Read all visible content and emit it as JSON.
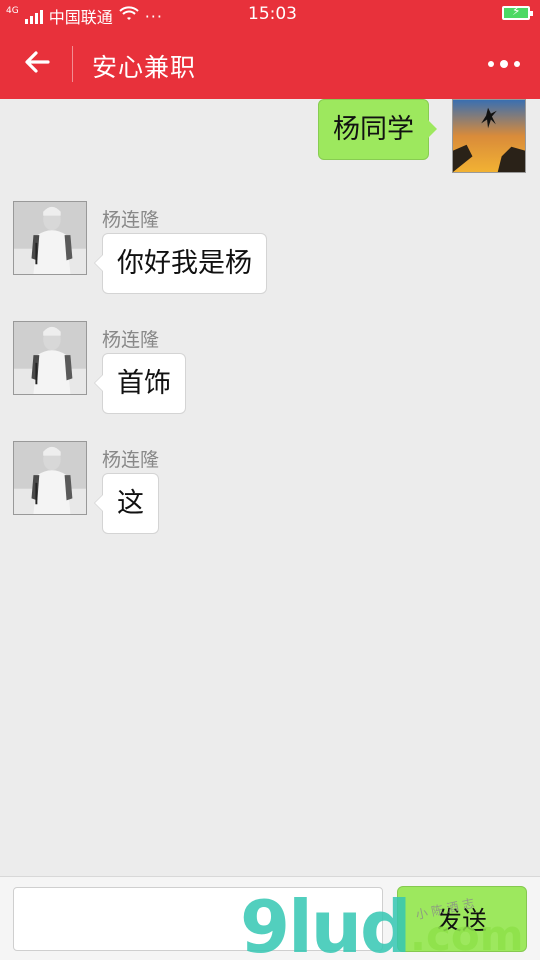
{
  "status_bar": {
    "network": "4G",
    "carrier": "中国联通",
    "time": "15:03"
  },
  "header": {
    "title": "安心兼职"
  },
  "messages": [
    {
      "direction": "out",
      "text": "杨同学"
    },
    {
      "direction": "in",
      "sender": "杨连隆",
      "text": "你好我是杨"
    },
    {
      "direction": "in",
      "sender": "杨连隆",
      "text": "首饰"
    },
    {
      "direction": "in",
      "sender": "杨连隆",
      "text": "这"
    }
  ],
  "input_bar": {
    "value": "",
    "send_label": "发送"
  },
  "watermark": {
    "text": "91ud.com",
    "tagline": "小 陈 酒 志"
  },
  "colors": {
    "header_red": "#e8313b",
    "bubble_green": "#9de85e",
    "bubble_white": "#ffffff",
    "chat_background": "#ececec"
  },
  "icons": {
    "back": "arrow-left-icon",
    "more": "more-dots-icon",
    "wifi": "wifi-icon",
    "battery": "battery-charging-icon",
    "signal": "signal-bars-icon"
  }
}
